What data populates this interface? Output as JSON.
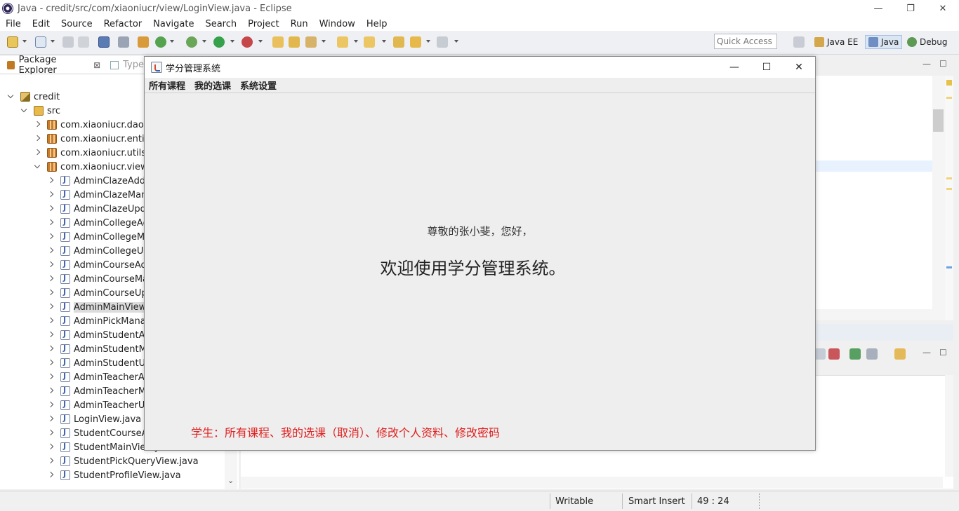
{
  "eclipse": {
    "title": "Java - credit/src/com/xiaoniucr/view/LoginView.java - Eclipse",
    "window_controls": {
      "minimize": "—",
      "restore": "❐",
      "close": "✕"
    },
    "menu": [
      "File",
      "Edit",
      "Source",
      "Refactor",
      "Navigate",
      "Search",
      "Project",
      "Run",
      "Window",
      "Help"
    ],
    "quick_access": {
      "placeholder": "Quick Access"
    },
    "perspectives": [
      {
        "label": "Java EE",
        "active": false
      },
      {
        "label": "Java",
        "active": true
      },
      {
        "label": "Debug",
        "active": false
      }
    ]
  },
  "package_explorer": {
    "tab_label": "Package Explorer",
    "close_glyph": "⊠",
    "second_tab_label": "Type",
    "tree": [
      {
        "label": "credit",
        "type": "project",
        "depth": 0,
        "state": "open"
      },
      {
        "label": "src",
        "type": "src",
        "depth": 1,
        "state": "open"
      },
      {
        "label": "com.xiaoniucr.dao",
        "type": "package",
        "depth": 2,
        "state": "closed"
      },
      {
        "label": "com.xiaoniucr.entity",
        "type": "package",
        "depth": 2,
        "state": "closed"
      },
      {
        "label": "com.xiaoniucr.utils",
        "type": "package",
        "depth": 2,
        "state": "closed"
      },
      {
        "label": "com.xiaoniucr.view",
        "type": "package",
        "depth": 2,
        "state": "open"
      },
      {
        "label": "AdminClazeAddView.java",
        "type": "java",
        "depth": 3,
        "state": "closed"
      },
      {
        "label": "AdminClazeManageView.java",
        "type": "java",
        "depth": 3,
        "state": "closed"
      },
      {
        "label": "AdminClazeUpdateView.java",
        "type": "java",
        "depth": 3,
        "state": "closed"
      },
      {
        "label": "AdminCollegeAddView.java",
        "type": "java",
        "depth": 3,
        "state": "closed"
      },
      {
        "label": "AdminCollegeManageView.java",
        "type": "java",
        "depth": 3,
        "state": "closed"
      },
      {
        "label": "AdminCollegeUpdateView.java",
        "type": "java",
        "depth": 3,
        "state": "closed"
      },
      {
        "label": "AdminCourseAddView.java",
        "type": "java",
        "depth": 3,
        "state": "closed"
      },
      {
        "label": "AdminCourseManageView.java",
        "type": "java",
        "depth": 3,
        "state": "closed"
      },
      {
        "label": "AdminCourseUpdateView.java",
        "type": "java",
        "depth": 3,
        "state": "closed"
      },
      {
        "label": "AdminMainView.java",
        "type": "java",
        "depth": 3,
        "state": "closed",
        "selected": true
      },
      {
        "label": "AdminPickManageView.java",
        "type": "java",
        "depth": 3,
        "state": "closed"
      },
      {
        "label": "AdminStudentAddView.java",
        "type": "java",
        "depth": 3,
        "state": "closed"
      },
      {
        "label": "AdminStudentManageView.java",
        "type": "java",
        "depth": 3,
        "state": "closed"
      },
      {
        "label": "AdminStudentUpdateView.java",
        "type": "java",
        "depth": 3,
        "state": "closed"
      },
      {
        "label": "AdminTeacherAddView.java",
        "type": "java",
        "depth": 3,
        "state": "closed"
      },
      {
        "label": "AdminTeacherManageView.java",
        "type": "java",
        "depth": 3,
        "state": "closed"
      },
      {
        "label": "AdminTeacherUpdateView.java",
        "type": "java",
        "depth": 3,
        "state": "closed"
      },
      {
        "label": "LoginView.java",
        "type": "java",
        "depth": 3,
        "state": "closed"
      },
      {
        "label": "StudentCourseAllView.java",
        "type": "java",
        "depth": 3,
        "state": "closed"
      },
      {
        "label": "StudentMainView.java",
        "type": "java",
        "depth": 3,
        "state": "closed"
      },
      {
        "label": "StudentPickQueryView.java",
        "type": "java",
        "depth": 3,
        "state": "closed"
      },
      {
        "label": "StudentProfileView.java",
        "type": "java",
        "depth": 3,
        "state": "closed"
      }
    ]
  },
  "status_bar": {
    "writable": "Writable",
    "insert_mode": "Smart Insert",
    "position": "49 : 24"
  },
  "dialog": {
    "title": "学分管理系统",
    "controls": {
      "minimize": "—",
      "maximize": "☐",
      "close": "✕"
    },
    "menu": [
      "所有课程",
      "我的选课",
      "系统设置"
    ],
    "greeting": "尊敬的张小斐，您好，",
    "welcome": "欢迎使用学分管理系统。",
    "note": "学生：所有课程、我的选课（取消）、修改个人资料、修改密码",
    "note_color": "#e02020"
  }
}
